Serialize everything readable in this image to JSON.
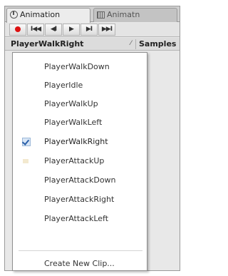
{
  "tabs": [
    {
      "label": "Animation",
      "icon": "animation-clock-icon",
      "active": true
    },
    {
      "label": "Animatn",
      "icon": "grid-icon",
      "active": false
    }
  ],
  "toolbar": {
    "record_icon": "record-icon",
    "buttons": [
      "I◀◀",
      "◀I",
      "▶",
      "▶I",
      "▶▶I"
    ],
    "button_icons": [
      "first-key-icon",
      "prev-key-icon",
      "play-icon",
      "next-key-icon",
      "last-key-icon"
    ],
    "record_color": "#d11111"
  },
  "clip_selector": {
    "current": "PlayerWalkRight",
    "arrow": "⁄",
    "samples_label": "Samples"
  },
  "menu": {
    "items": [
      {
        "label": "PlayerWalkDown",
        "checked": false
      },
      {
        "label": "PlayerIdle",
        "checked": false
      },
      {
        "label": "PlayerWalkUp",
        "checked": false
      },
      {
        "label": "PlayerWalkLeft",
        "checked": false
      },
      {
        "label": "PlayerWalkRight",
        "checked": true
      },
      {
        "label": "PlayerAttackUp",
        "checked": false
      },
      {
        "label": "PlayerAttackDown",
        "checked": false
      },
      {
        "label": "PlayerAttackRight",
        "checked": false
      },
      {
        "label": "PlayerAttackLeft",
        "checked": false
      }
    ],
    "create_label": "Create New Clip..."
  }
}
